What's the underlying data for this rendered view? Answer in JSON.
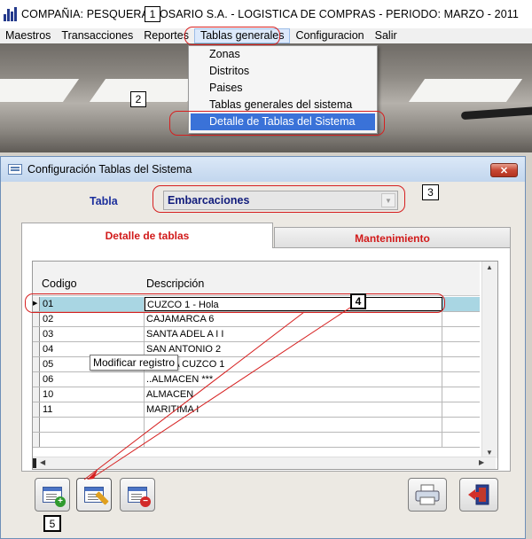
{
  "app": {
    "title": "COMPAÑIA:  PESQUERA ROSARIO S.A.    -    LOGISTICA DE COMPRAS    -    PERIODO: MARZO - 2011"
  },
  "menubar": {
    "items": [
      "Maestros",
      "Transacciones",
      "Reportes",
      "Tablas generales",
      "Configuracion",
      "Salir"
    ]
  },
  "dropdown": {
    "items": [
      "Zonas",
      "Distritos",
      "Paises",
      "Tablas generales del sistema",
      "Detalle de Tablas del Sistema"
    ]
  },
  "annotations": [
    "1",
    "2",
    "3",
    "4",
    "5"
  ],
  "dialog": {
    "title": "Configuración Tablas del Sistema",
    "close_label": "✕",
    "tabla_label": "Tabla",
    "tabla_value": "Embarcaciones",
    "tabs": [
      "Detalle de tablas",
      "Mantenimiento"
    ],
    "grid": {
      "columns": [
        "Codigo",
        "Descripción"
      ],
      "rows": [
        {
          "code": "01",
          "desc": "CUZCO 1 - Hola"
        },
        {
          "code": "02",
          "desc": "CAJAMARCA 6"
        },
        {
          "code": "03",
          "desc": "SANTA ADEL A I I"
        },
        {
          "code": "04",
          "desc": "SAN ANTONIO 2"
        },
        {
          "code": "05",
          "desc": "PANGA CUZCO 1"
        },
        {
          "code": "06",
          "desc": "..ALMACEN ***"
        },
        {
          "code": "10",
          "desc": "ALMACEN"
        },
        {
          "code": "11",
          "desc": "MARITIMA I"
        }
      ]
    },
    "buttons": {
      "add": "add-record-icon",
      "edit": "edit-record-icon",
      "delete": "delete-record-icon",
      "print": "printer-icon",
      "exit": "exit-door-icon"
    },
    "tooltip": "Modificar registro"
  },
  "colors": {
    "annotation": "#d62020",
    "menu_highlight": "#3a72d8",
    "tab_text": "#d11a1a",
    "label_blue": "#1c2f9c",
    "selected_row": "#a9d6e3"
  }
}
